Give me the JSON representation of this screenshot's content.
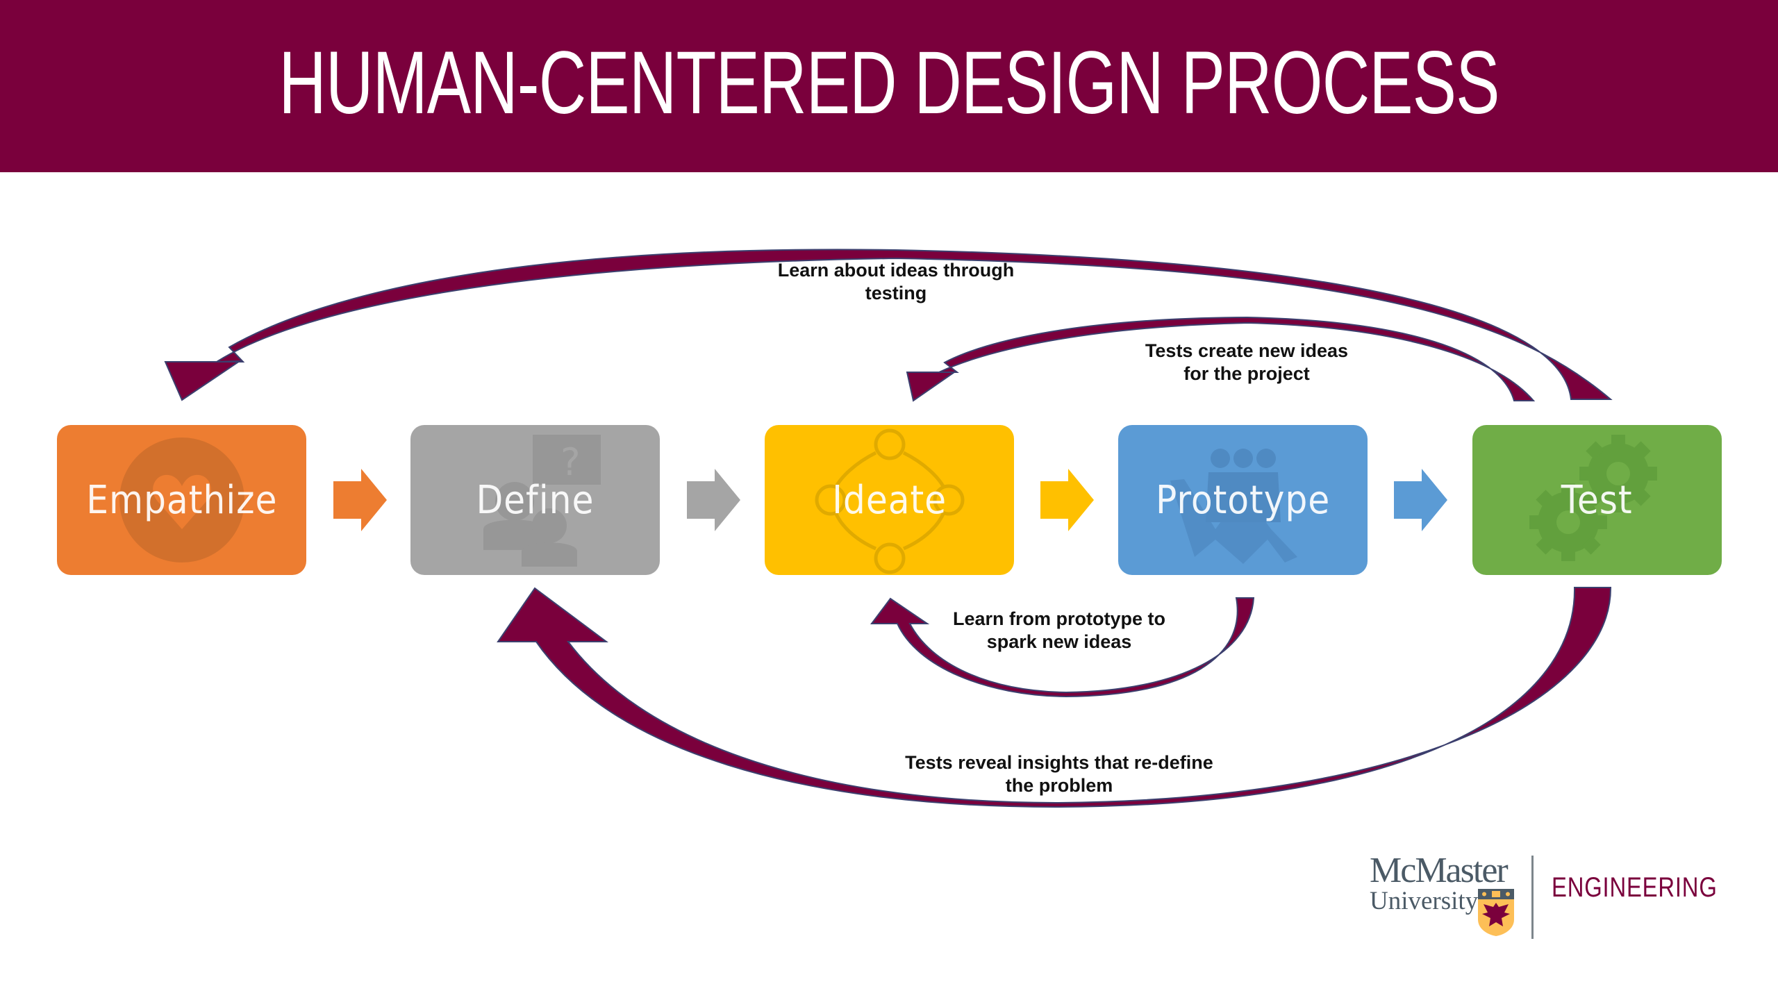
{
  "header": {
    "title": "HUMAN-CENTERED DESIGN PROCESS",
    "background_color": "#7a003c"
  },
  "stages": [
    {
      "label": "Empathize",
      "color": "#ed7d31",
      "icon": "heart-icon"
    },
    {
      "label": "Define",
      "color": "#a5a5a5",
      "icon": "people-question-icon"
    },
    {
      "label": "Ideate",
      "color": "#ffc000",
      "icon": "idea-network-icon"
    },
    {
      "label": "Prototype",
      "color": "#5b9bd5",
      "icon": "team-icon"
    },
    {
      "label": "Test",
      "color": "#70ad47",
      "icon": "gears-icon"
    }
  ],
  "connector_arrows": [
    {
      "from": "Empathize",
      "to": "Define",
      "color": "#ed7d31"
    },
    {
      "from": "Define",
      "to": "Ideate",
      "color": "#a5a5a5"
    },
    {
      "from": "Ideate",
      "to": "Prototype",
      "color": "#ffc000"
    },
    {
      "from": "Prototype",
      "to": "Test",
      "color": "#5b9bd5"
    }
  ],
  "feedback_loops": [
    {
      "from": "Test",
      "to": "Empathize",
      "label": "Learn about ideas through testing"
    },
    {
      "from": "Test",
      "to": "Ideate",
      "label": "Tests create new ideas for the project"
    },
    {
      "from": "Prototype",
      "to": "Ideate",
      "label": "Learn from prototype to spark new ideas"
    },
    {
      "from": "Test",
      "to": "Define",
      "label": "Tests reveal insights that re-define the problem"
    }
  ],
  "loop_color": "#7a003c",
  "footer": {
    "logo_line1": "McMaster",
    "logo_line2": "University",
    "faculty": "ENGINEERING"
  }
}
